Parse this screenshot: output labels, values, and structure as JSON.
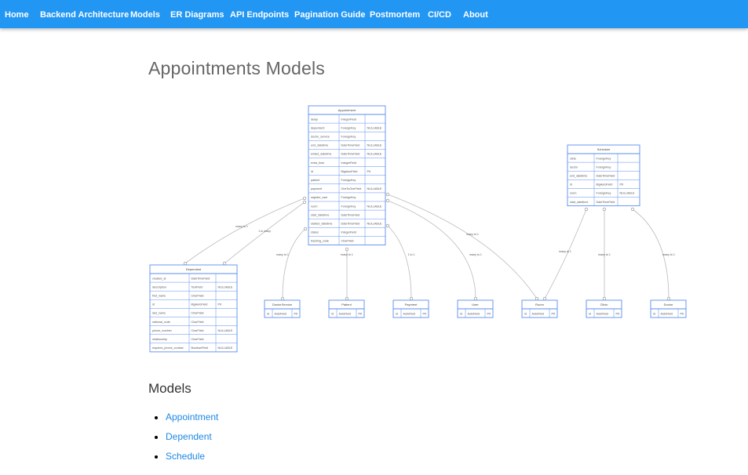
{
  "nav": [
    {
      "label": "Home"
    },
    {
      "label": "Backend Architecture"
    },
    {
      "label": "Models"
    },
    {
      "label": "ER Diagrams"
    },
    {
      "label": "API Endpoints"
    },
    {
      "label": "Pagination Guide"
    },
    {
      "label": "Postmortem"
    },
    {
      "label": "CI/CD"
    },
    {
      "label": "About"
    }
  ],
  "page_title": "Appointments Models",
  "diagram": {
    "colors": {
      "nav": "#2196f3",
      "entity_border": "#5b8def",
      "edge": "#bbbbbb",
      "link": "#1e88e5"
    },
    "entities": [
      {
        "name": "Appointment",
        "rows": [
          [
            "delay",
            "IntegerField",
            ""
          ],
          [
            "dependent",
            "ForeignKey",
            "NULLABLE"
          ],
          [
            "doctor_service",
            "ForeignKey",
            ""
          ],
          [
            "end_datetime",
            "DateTimeField",
            "NULLABLE"
          ],
          [
            "ended_datetime",
            "DateTimeField",
            "NULLABLE"
          ],
          [
            "extra_time",
            "IntegerField",
            ""
          ],
          [
            "id",
            "BigAutoField",
            "PK"
          ],
          [
            "patient",
            "ForeignKey",
            ""
          ],
          [
            "payment",
            "OneToOneField",
            "NULLABLE"
          ],
          [
            "register_user",
            "ForeignKey",
            ""
          ],
          [
            "room",
            "ForeignKey",
            "NULLABLE"
          ],
          [
            "start_datetime",
            "DateTimeField",
            ""
          ],
          [
            "started_datetime",
            "DateTimeField",
            "NULLABLE"
          ],
          [
            "status",
            "IntegerField",
            ""
          ],
          [
            "tracking_code",
            "CharField",
            ""
          ]
        ]
      },
      {
        "name": "Schedule",
        "rows": [
          [
            "clinic",
            "ForeignKey",
            ""
          ],
          [
            "doctor",
            "ForeignKey",
            ""
          ],
          [
            "end_datetime",
            "DateTimeField",
            ""
          ],
          [
            "id",
            "BigAutoField",
            "PK"
          ],
          [
            "room",
            "ForeignKey",
            "NULLABLE"
          ],
          [
            "start_datetime",
            "DateTimeField",
            ""
          ]
        ]
      },
      {
        "name": "Dependent",
        "rows": [
          [
            "created_at",
            "DateTimeField",
            ""
          ],
          [
            "description",
            "TextField",
            "NULLABLE"
          ],
          [
            "first_name",
            "CharField",
            ""
          ],
          [
            "id",
            "BigAutoField",
            "PK"
          ],
          [
            "last_name",
            "CharField",
            ""
          ],
          [
            "national_code",
            "CharField",
            ""
          ],
          [
            "phone_number",
            "CharField",
            "NULLABLE"
          ],
          [
            "relationship",
            "CharField",
            ""
          ],
          [
            "requires_phone_contact",
            "BooleanField",
            "NULLABLE"
          ]
        ]
      },
      {
        "name": "DoctorService",
        "rows": [
          [
            "id",
            "AutoField",
            "PK"
          ]
        ]
      },
      {
        "name": "Patient",
        "rows": [
          [
            "id",
            "AutoField",
            "PK"
          ]
        ]
      },
      {
        "name": "Payment",
        "rows": [
          [
            "id",
            "AutoField",
            "PK"
          ]
        ]
      },
      {
        "name": "User",
        "rows": [
          [
            "id",
            "AutoField",
            "PK"
          ]
        ]
      },
      {
        "name": "Room",
        "rows": [
          [
            "id",
            "AutoField",
            "PK"
          ]
        ]
      },
      {
        "name": "Clinic",
        "rows": [
          [
            "id",
            "AutoField",
            "PK"
          ]
        ]
      },
      {
        "name": "Doctor",
        "rows": [
          [
            "id",
            "AutoField",
            "PK"
          ]
        ]
      }
    ],
    "relations": [
      {
        "label": "many to 1",
        "from": "Appointment",
        "to": "Dependent"
      },
      {
        "label": "1 to many",
        "from": "Appointment",
        "to": "Dependent"
      },
      {
        "label": "many to 1",
        "from": "Appointment",
        "to": "DoctorService"
      },
      {
        "label": "many to 1",
        "from": "Appointment",
        "to": "Patient"
      },
      {
        "label": "1 to 1",
        "from": "Appointment",
        "to": "Payment"
      },
      {
        "label": "many to 1",
        "from": "Appointment",
        "to": "User"
      },
      {
        "label": "many to 1",
        "from": "Appointment",
        "to": "Room"
      },
      {
        "label": "many to 1",
        "from": "Schedule",
        "to": "Room"
      },
      {
        "label": "many to 1",
        "from": "Schedule",
        "to": "Clinic"
      },
      {
        "label": "many to 1",
        "from": "Schedule",
        "to": "Doctor"
      }
    ]
  },
  "models_heading": "Models",
  "model_links": [
    {
      "label": "Appointment"
    },
    {
      "label": "Dependent"
    },
    {
      "label": "Schedule"
    }
  ]
}
